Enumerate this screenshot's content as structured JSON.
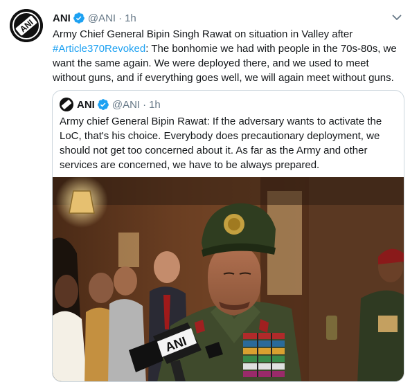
{
  "tweet": {
    "author_name": "ANI",
    "handle": "@ANI",
    "separator": "·",
    "time": "1h",
    "text_before": "Army Chief General Bipin Singh Rawat on situation in Valley after ",
    "hashtag": "#Article370Revoked",
    "text_after": ": The bonhomie we had with people in the 70s-80s, we want the same again. We were deployed there, and we used to meet without guns, and if everything goes well, we will again meet without guns."
  },
  "quoted": {
    "author_name": "ANI",
    "handle": "@ANI",
    "separator": "·",
    "time": "1h",
    "text": "Army chief General Bipin Rawat: If the adversary wants to activate the LoC, that's his choice. Everybody does precautionary deployment, we should not get too concerned about it. As far as the Army and other services are concerned, we have to be always prepared.",
    "media_mic_logo": "ANI"
  },
  "avatar_logo": "ANI",
  "icons": {
    "verified": "verified-badge-icon",
    "menu": "chevron-down-icon"
  },
  "colors": {
    "link": "#1da1f2",
    "secondary_text": "#657786",
    "border": "#ccd6dd",
    "uniform": "#3f4a2c",
    "beret": "#2f3d20"
  }
}
